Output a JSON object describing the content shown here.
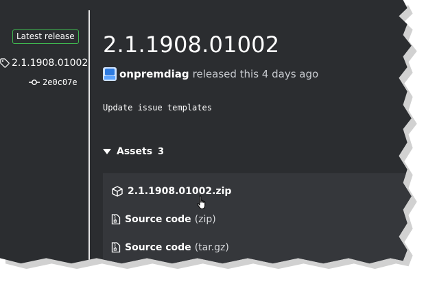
{
  "sidebar": {
    "badge": "Latest release",
    "tag": "2.1.1908.01002",
    "commit": "2e0c07e"
  },
  "release": {
    "title": "2.1.1908.01002",
    "author": "onpremdiag",
    "released_text": "released this 4 days ago",
    "notes": "Update issue templates"
  },
  "assets": {
    "label": "Assets",
    "count": "3",
    "items": [
      {
        "name": "2.1.1908.01002.zip",
        "suffix": "",
        "icon": "package-icon"
      },
      {
        "name": "Source code",
        "suffix": "(zip)",
        "icon": "file-zip-icon"
      },
      {
        "name": "Source code",
        "suffix": "(tar.gz)",
        "icon": "file-zip-icon"
      }
    ]
  },
  "colors": {
    "background": "#2b2d30",
    "badge_border": "#3fb950",
    "assets_panel": "#35373b"
  }
}
